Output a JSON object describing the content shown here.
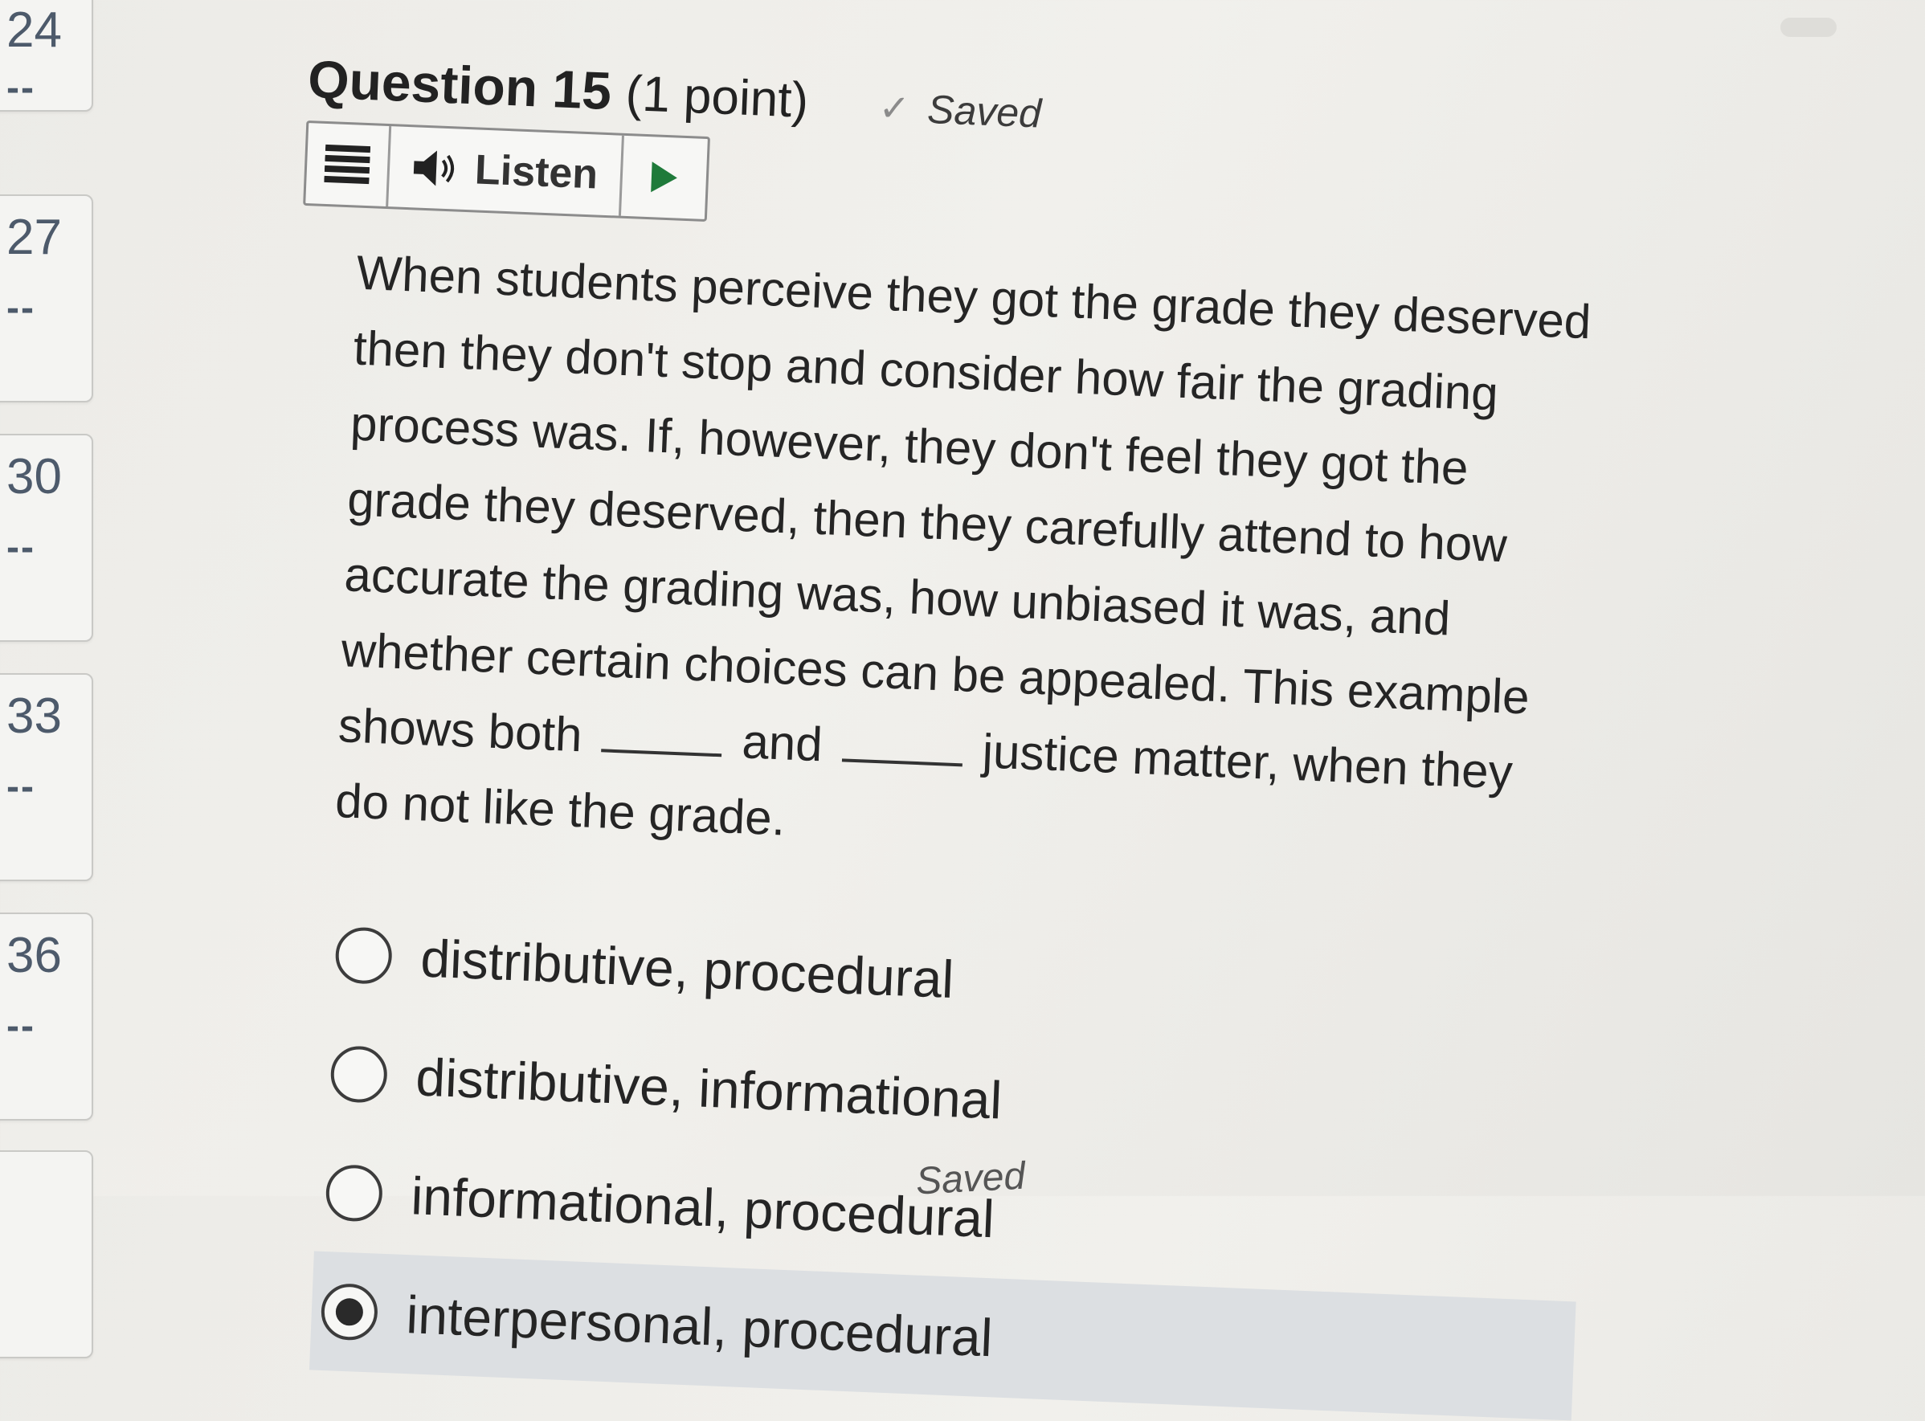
{
  "nav": {
    "items": [
      {
        "number": "24",
        "status": "--"
      },
      {
        "number": "27",
        "status": "--"
      },
      {
        "number": "30",
        "status": "--"
      },
      {
        "number": "33",
        "status": "--"
      },
      {
        "number": "36",
        "status": "--"
      }
    ]
  },
  "question": {
    "title": "Question 15",
    "points": "(1 point)",
    "saved_label": "Saved",
    "text_part1": "When students perceive they got the grade they deserved then they don't stop and consider how fair the grading process was. If, however, they don't feel they got the grade they deserved, then they carefully attend to how accurate the grading was, how unbiased it was, and whether certain choices can be appealed. This example shows both",
    "text_and": "and",
    "text_part2": "justice matter, when they do not like the grade."
  },
  "toolbar": {
    "listen_label": "Listen"
  },
  "options": [
    {
      "label": "distributive, procedural",
      "selected": false
    },
    {
      "label": "distributive, informational",
      "selected": false
    },
    {
      "label": "informational, procedural",
      "selected": false
    },
    {
      "label": "interpersonal, procedural",
      "selected": true
    }
  ],
  "footer": {
    "saved_label": "Saved"
  },
  "colors": {
    "selected_background": "#dcdfe2",
    "play_icon": "#1f7a3a",
    "nav_text": "#4d5a6b"
  },
  "icons": {
    "menu": "menu-icon",
    "speaker": "speaker-icon",
    "play": "play-icon",
    "check": "check-icon"
  }
}
